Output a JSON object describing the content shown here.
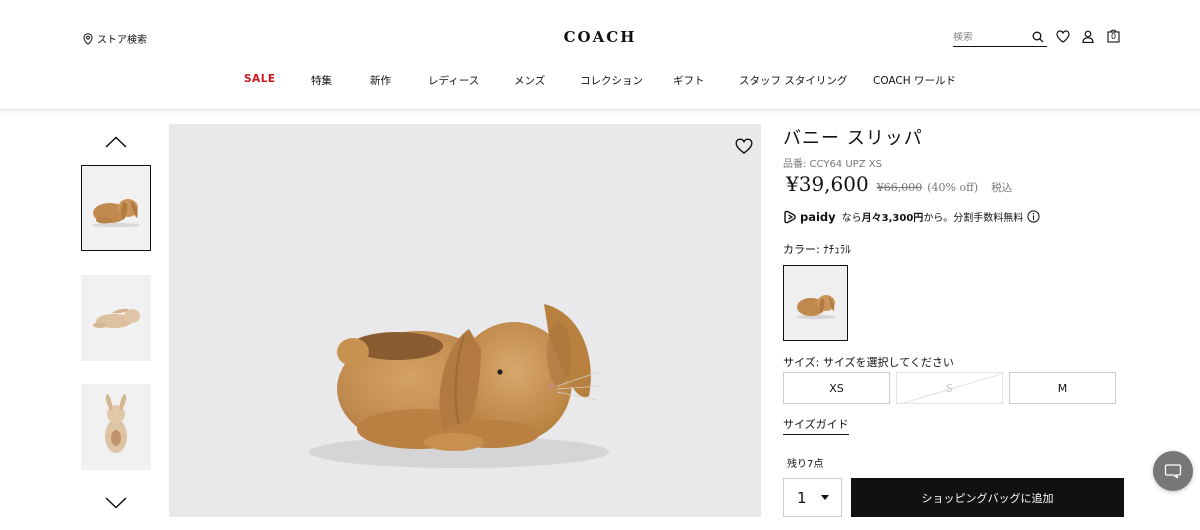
{
  "header": {
    "store_search_label": "ストア検索",
    "logo_text": "COACH",
    "search_placeholder": "検索",
    "bag_count": "0"
  },
  "nav": {
    "items": [
      "SALE",
      "特集",
      "新作",
      "レディース",
      "メンズ",
      "コレクション",
      "ギフト",
      "スタッフ スタイリング",
      "COACH ワールド"
    ]
  },
  "product": {
    "title": "バニー スリッパ",
    "sku": "品番: CCY64 UPZ XS",
    "price": "¥39,600",
    "original_price": "¥66,000",
    "discount": "(40% off)",
    "tax_label": "税込",
    "paidy": {
      "logo": "paidy",
      "text_prefix": "なら",
      "text_bold": "月々3,300円",
      "text_suffix": "から。分割手数料無料"
    },
    "color_label": "カラー: ﾅﾁｭﾗﾙ",
    "size_label": "サイズ: サイズを選択してください",
    "sizes": [
      {
        "label": "XS",
        "available": true
      },
      {
        "label": "S",
        "available": false
      },
      {
        "label": "M",
        "available": true
      }
    ],
    "size_guide_label": "サイズガイド",
    "stock_text": "残り7点",
    "quantity": "1",
    "add_to_bag_label": "ショッピングバッグに追加"
  },
  "colors": {
    "sale": "#d0141c",
    "primary_button": "#111111",
    "chat_button": "#777777",
    "product_tan": "#c08a4e"
  },
  "icons": [
    "location-pin-icon",
    "search-icon",
    "heart-icon",
    "user-icon",
    "bag-icon",
    "chevron-up-icon",
    "chevron-down-icon",
    "info-icon",
    "paidy-logo-icon",
    "chat-icon",
    "caret-down-icon"
  ]
}
